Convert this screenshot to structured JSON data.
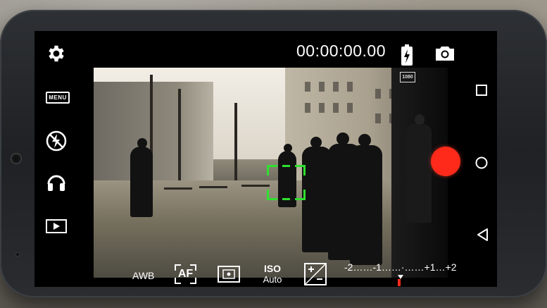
{
  "status": {
    "timer": "00:00:00.00",
    "resolution_badge": "1080"
  },
  "left_panel": {
    "items": [
      {
        "name": "settings",
        "icon": "gear-icon"
      },
      {
        "name": "menu",
        "label": "MENU"
      },
      {
        "name": "flash",
        "icon": "flash-auto-icon"
      },
      {
        "name": "audio",
        "icon": "headphones-icon"
      },
      {
        "name": "playback",
        "icon": "play-icon"
      }
    ]
  },
  "right_panel": {
    "battery_icon": "battery-charging-icon",
    "photo_icon": "camera-icon",
    "record_color": "#ff2a1a"
  },
  "nav_bar": {
    "icons": [
      "recent-apps-icon",
      "home-icon",
      "back-icon"
    ]
  },
  "bottom_bar": {
    "awb_label": "AWB",
    "af_label": "AF",
    "iso_label": "ISO",
    "iso_value": "Auto",
    "exposure_scale": "-2……-1……·……+1…+2",
    "exposure_value": 0
  },
  "focus_indicator_color": "#2fe02f"
}
